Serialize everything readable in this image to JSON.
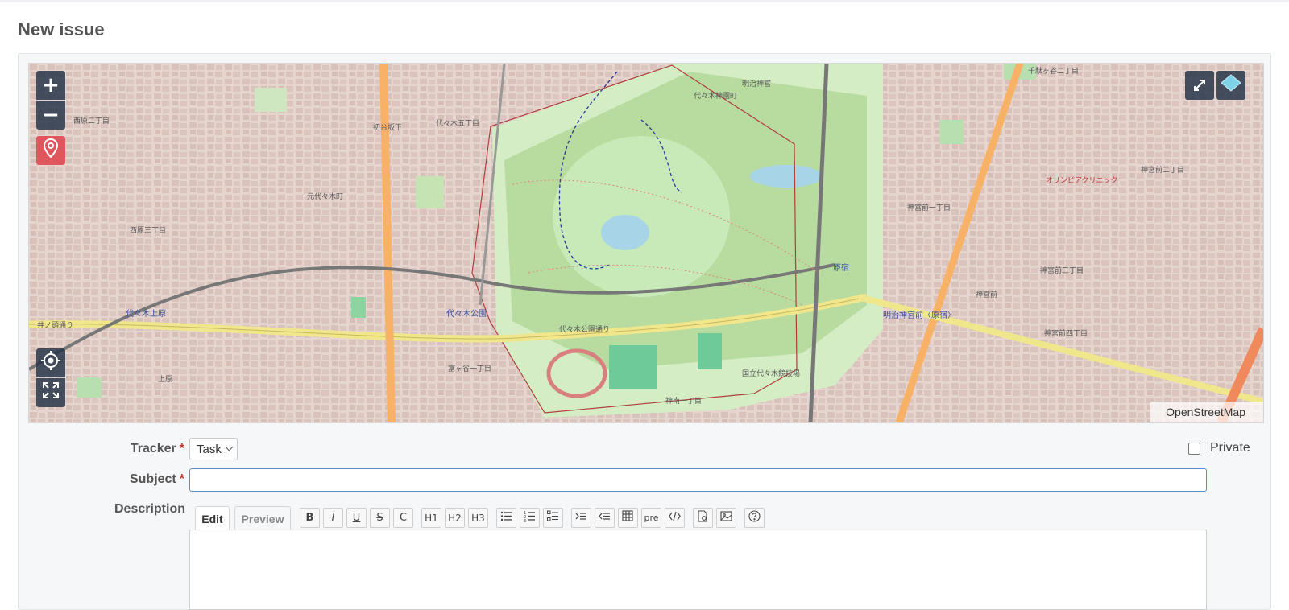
{
  "page": {
    "title": "New issue"
  },
  "map": {
    "attribution": "OpenStreetMap",
    "zoom_in_label": "+",
    "zoom_out_label": "−",
    "labels": {
      "l1": "西原二丁目",
      "l2": "代々木五丁目",
      "l3": "初台坂下",
      "l4": "元代々木町",
      "l5": "西原三丁目",
      "l6": "代々木神園町",
      "l7": "明治神宮",
      "l8": "代々木公園",
      "l9": "井ノ頭通り",
      "l10": "代々木公園通り",
      "l11": "富ヶ谷一丁目",
      "l12": "神南一丁目",
      "l13": "国立代々木競技場",
      "l14": "原宿",
      "l15": "神宮前",
      "l16": "明治神宮前〈原宿〉",
      "l17": "神宮前一丁目",
      "l18": "神宮前三丁目",
      "l19": "神宮前四丁目",
      "l20": "千駄ヶ谷二丁目",
      "l21": "上原",
      "l22": "代々木上原",
      "l23": "神宮前二丁目",
      "l24": "オリンピアクリニック"
    }
  },
  "form": {
    "tracker": {
      "label": "Tracker",
      "required_mark": "*",
      "value": "Task"
    },
    "subject": {
      "label": "Subject",
      "required_mark": "*",
      "value": ""
    },
    "private_label": "Private",
    "description": {
      "label": "Description",
      "tab_edit": "Edit",
      "tab_preview": "Preview",
      "toolbar": {
        "bold": "B",
        "italic": "I",
        "underline": "U",
        "strike": "S",
        "code": "C",
        "h1": "H1",
        "h2": "H2",
        "h3": "H3",
        "pre": "pre"
      }
    }
  },
  "colors": {
    "map_control": "#28364a",
    "pin_button": "#e0565d",
    "park": "#c8eab8",
    "subject_border": "#5b8dc6",
    "required": "#c0302c"
  }
}
